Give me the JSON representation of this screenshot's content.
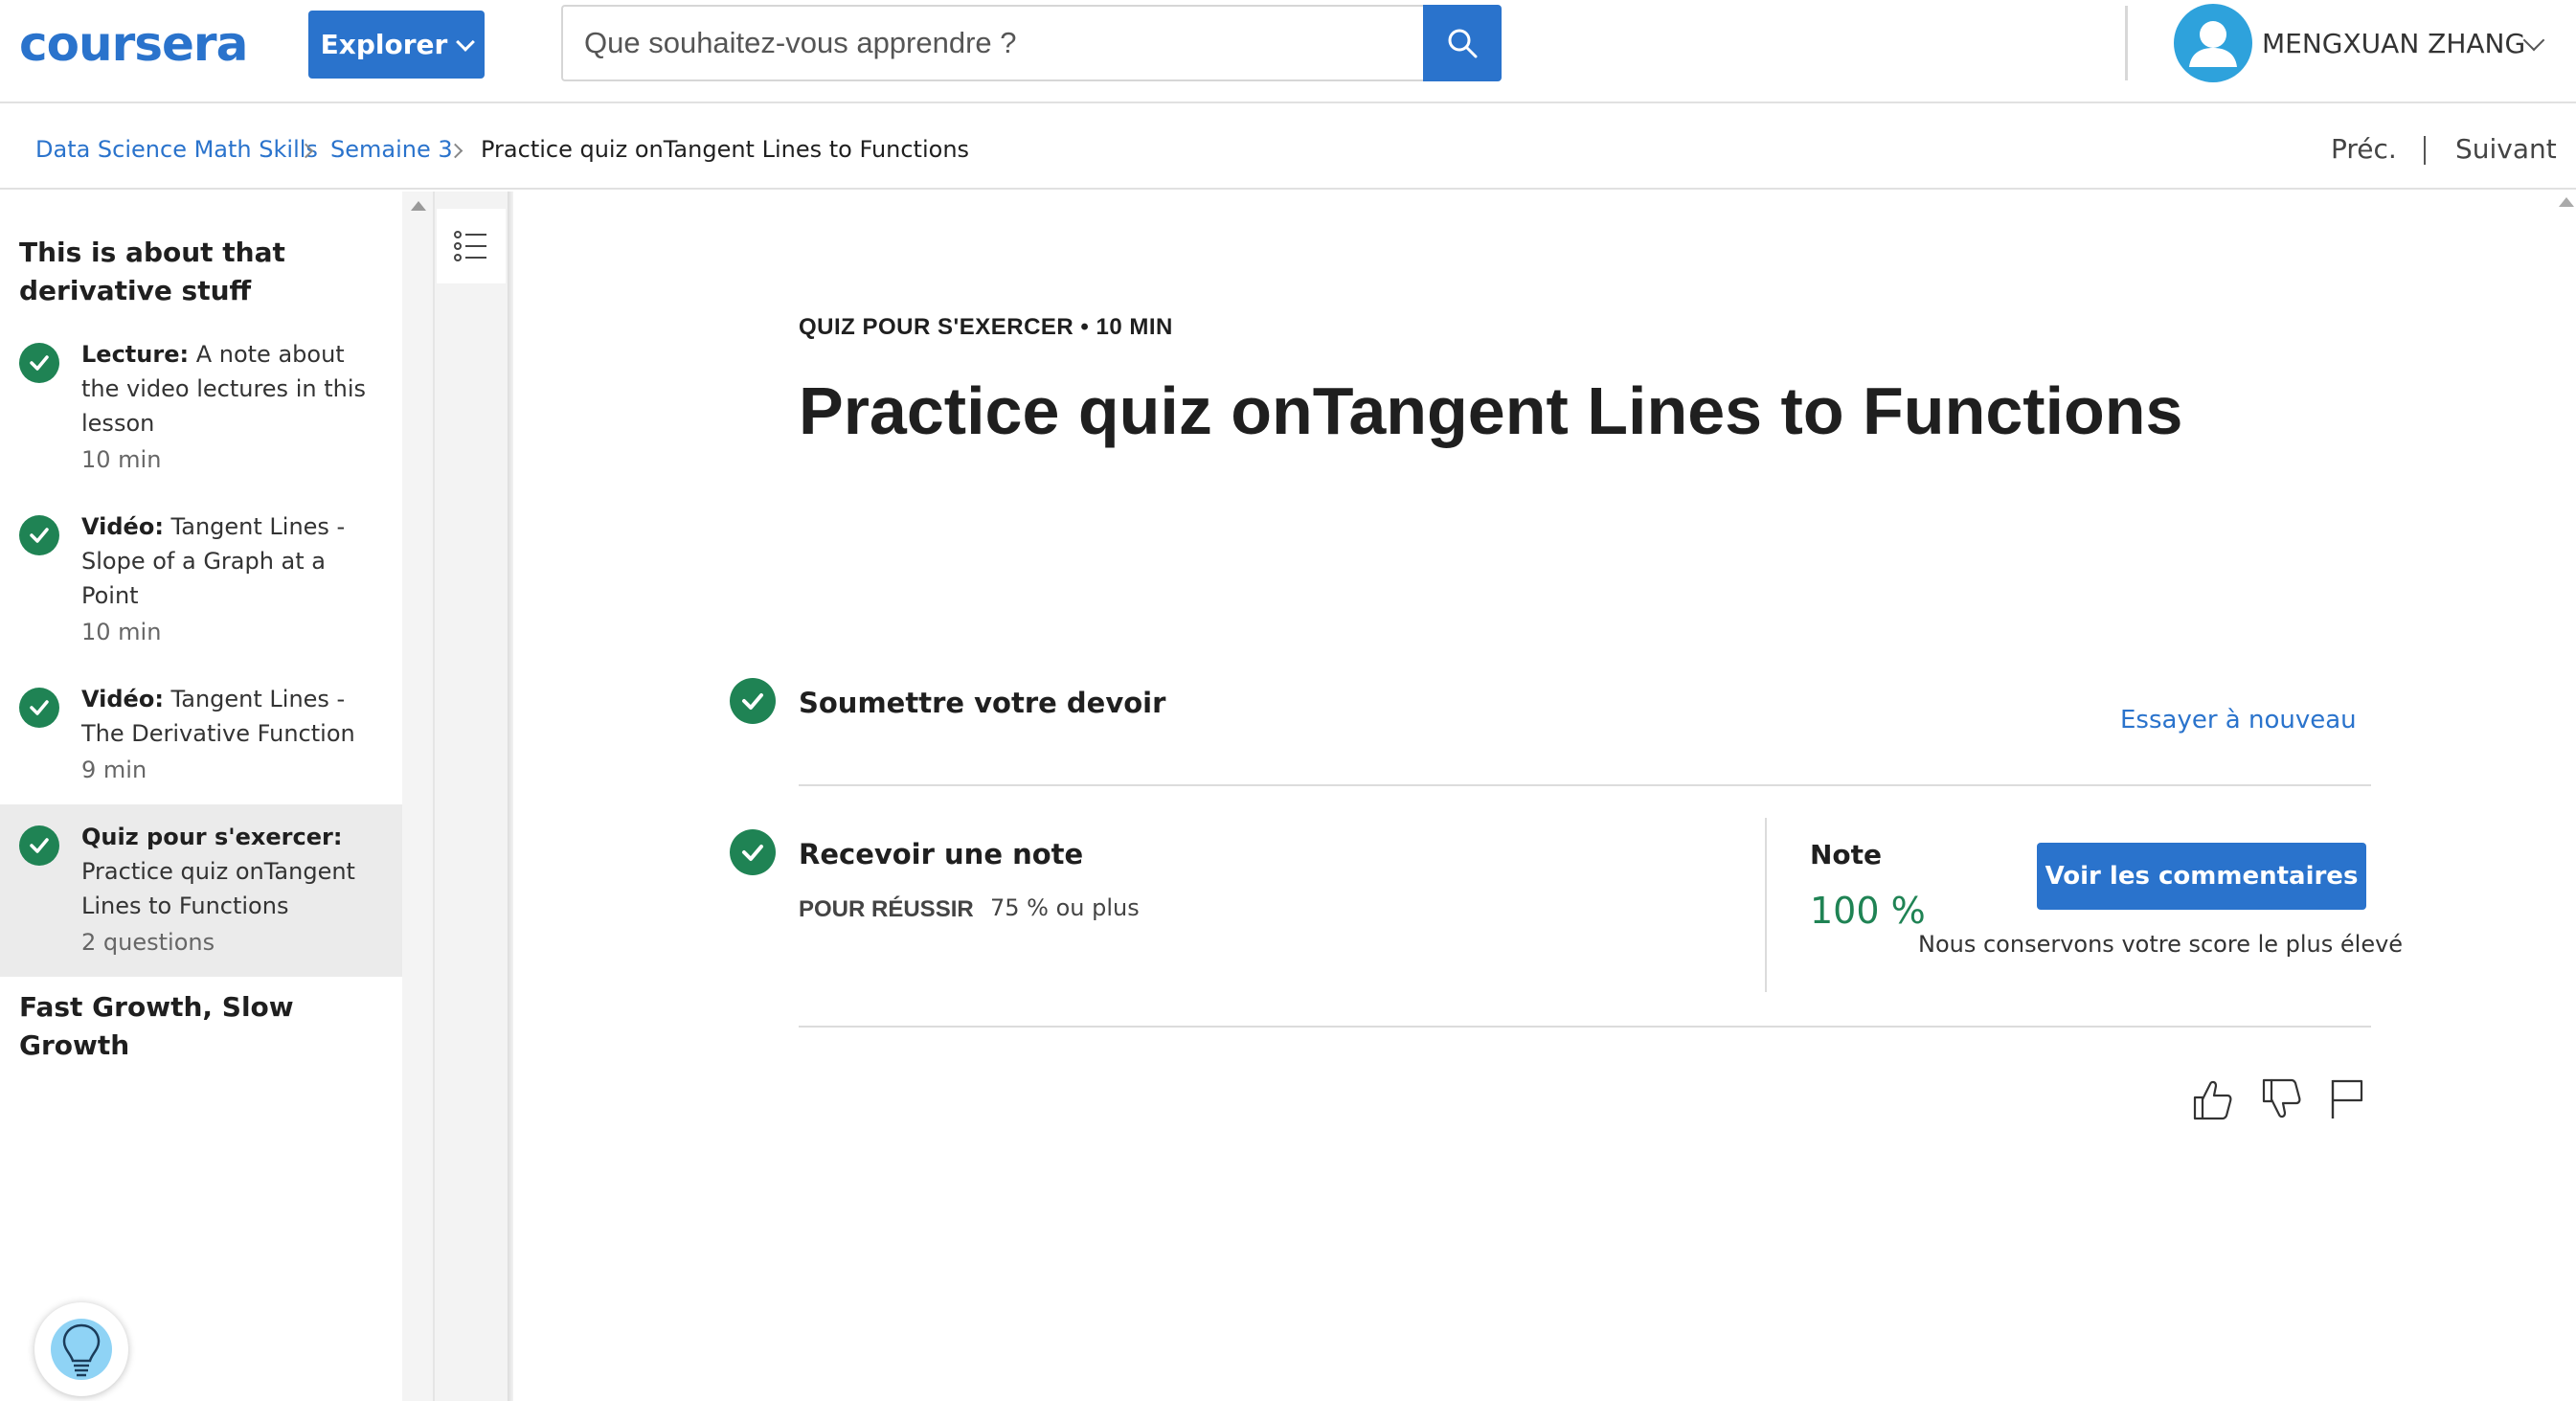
{
  "header": {
    "logo_text": "coursera",
    "explore_label": "Explorer",
    "search_placeholder": "Que souhaitez-vous apprendre ?",
    "user_name": "MENGXUAN ZHANG"
  },
  "breadcrumb": {
    "items": [
      "Data Science Math Skills",
      "Semaine 3",
      "Practice quiz onTangent Lines to Functions"
    ],
    "prev_label": "Préc.",
    "next_label": "Suivant"
  },
  "sidebar": {
    "section_title": "This is about that derivative stuff",
    "items": [
      {
        "type_label": "Lecture:",
        "title": " A note about the video lectures in this lesson",
        "meta": "10  min",
        "completed": true,
        "active": false
      },
      {
        "type_label": "Vidéo:",
        "title": " Tangent Lines - Slope of a Graph at a Point",
        "meta": "10  min",
        "completed": true,
        "active": false
      },
      {
        "type_label": "Vidéo:",
        "title": " Tangent Lines - The Derivative Function",
        "meta": "9  min",
        "completed": true,
        "active": false
      },
      {
        "type_label": "Quiz pour s'exercer:",
        "title": " Practice quiz onTangent Lines to Functions",
        "meta": "2 questions",
        "completed": true,
        "active": true
      }
    ],
    "next_section_title": "Fast Growth, Slow Growth"
  },
  "main": {
    "kicker": "QUIZ POUR S'EXERCER • 10  MIN",
    "title": "Practice quiz onTangent Lines to Functions",
    "submit_step": {
      "title": "Soumettre votre devoir",
      "retry_label": "Essayer à nouveau"
    },
    "grade_step": {
      "title": "Recevoir une note",
      "pass_label": "POUR RÉUSSIR",
      "pass_value": "75 % ou plus",
      "grade_label": "Note",
      "grade_value": "100 %",
      "feedback_button": "Voir les commentaires",
      "best_score_note": "Nous conservons votre score le plus élevé"
    }
  },
  "colors": {
    "brand_blue": "#2a73cc",
    "success_green": "#1f8354",
    "active_bg": "#ebebeb"
  },
  "icons": [
    "search-icon",
    "avatar-icon",
    "chevron-down-icon",
    "list-toggle-icon",
    "check-icon",
    "thumbs-up-icon",
    "thumbs-down-icon",
    "flag-icon",
    "lightbulb-icon"
  ]
}
